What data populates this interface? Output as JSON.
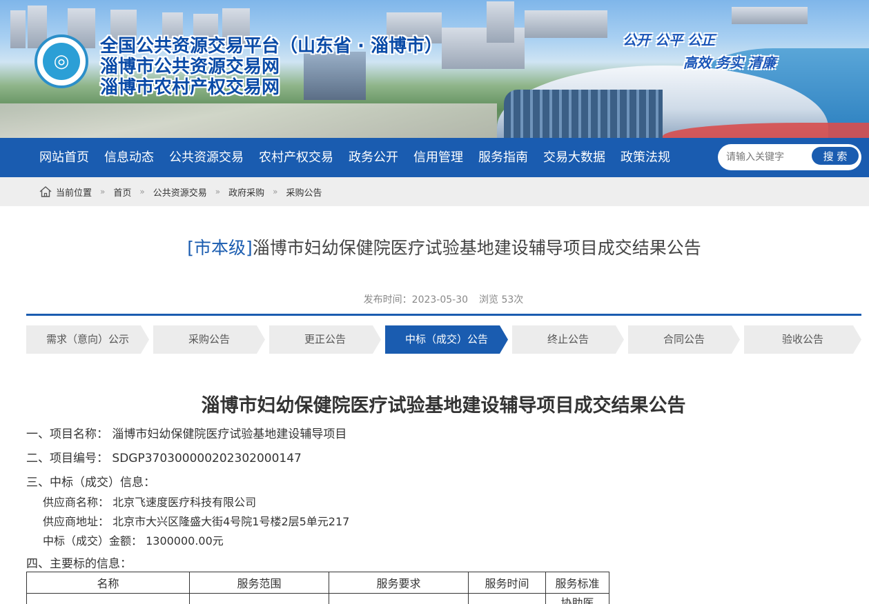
{
  "banner": {
    "logo_glyph": "◎",
    "titles": [
      "全国公共资源交易平台（山东省 · 淄博市）",
      "淄博市公共资源交易网",
      "淄博市农村产权交易网"
    ],
    "slogan_1": "公开  公平  公正",
    "slogan_2": "高效  务实  清廉"
  },
  "nav": {
    "items": [
      "网站首页",
      "信息动态",
      "公共资源交易",
      "农村产权交易",
      "政务公开",
      "信用管理",
      "服务指南",
      "交易大数据",
      "政策法规"
    ],
    "search_placeholder": "请输入关键字",
    "search_button": "搜 索"
  },
  "breadcrumb": {
    "items": [
      "当前位置",
      "首页",
      "公共资源交易",
      "政府采购",
      "采购公告"
    ],
    "separator": "»"
  },
  "article": {
    "tag": "[市本级]",
    "title": "淄博市妇幼保健院医疗试验基地建设辅导项目成交结果公告",
    "publish_time": "发布时间：2023-05-30",
    "views": "浏览 53次"
  },
  "steps": [
    {
      "label": "需求（意向）公示",
      "active": false
    },
    {
      "label": "采购公告",
      "active": false
    },
    {
      "label": "更正公告",
      "active": false
    },
    {
      "label": "中标（成交）公告",
      "active": true
    },
    {
      "label": "终止公告",
      "active": false
    },
    {
      "label": "合同公告",
      "active": false
    },
    {
      "label": "验收公告",
      "active": false
    }
  ],
  "doc": {
    "title": "淄博市妇幼保健院医疗试验基地建设辅导项目成交结果公告",
    "lines": {
      "project_name": "一、项目名称：  淄博市妇幼保健院医疗试验基地建设辅导项目",
      "project_no": "二、项目编号：  SDGP370300000202302000147",
      "winner_header": "三、中标（成交）信息：",
      "supplier_name": "供应商名称：  北京飞速度医疗科技有限公司",
      "supplier_addr": "供应商地址：  北京市大兴区隆盛大街4号院1号楼2层5单元217",
      "amount": "中标（成交）金额：  1300000.00元",
      "subject_header": "四、主要标的信息："
    },
    "table": {
      "headers": [
        "名称",
        "服务范围",
        "服务要求",
        "服务时间",
        "服务标准"
      ],
      "row1_partial": [
        "",
        "",
        "",
        "",
        "协助医"
      ]
    }
  }
}
